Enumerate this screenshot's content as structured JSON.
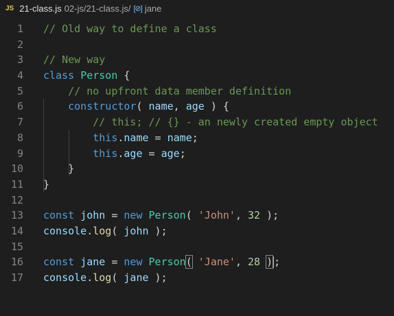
{
  "breadcrumb": {
    "language_badge": "JS",
    "file_name": "21-class.js",
    "path": "02-js/21-class.js/",
    "symbol_icon": "[⊘]",
    "symbol_name": "jane"
  },
  "lines": [
    {
      "n": "1",
      "tokens": [
        {
          "t": "// Old way to define a class",
          "c": "cm"
        }
      ]
    },
    {
      "n": "2",
      "tokens": []
    },
    {
      "n": "3",
      "tokens": [
        {
          "t": "// New way",
          "c": "cm"
        }
      ]
    },
    {
      "n": "4",
      "tokens": [
        {
          "t": "class",
          "c": "kw"
        },
        {
          "t": " ",
          "c": "plain"
        },
        {
          "t": "Person",
          "c": "cls"
        },
        {
          "t": " {",
          "c": "plain"
        }
      ]
    },
    {
      "n": "5",
      "tokens": [
        {
          "t": "    ",
          "c": "plain"
        },
        {
          "t": "// no upfront data member definition",
          "c": "cm"
        }
      ]
    },
    {
      "n": "6",
      "tokens": [
        {
          "t": "    ",
          "c": "plain"
        },
        {
          "t": "constructor",
          "c": "kw"
        },
        {
          "t": "( ",
          "c": "plain"
        },
        {
          "t": "name",
          "c": "var"
        },
        {
          "t": ", ",
          "c": "plain"
        },
        {
          "t": "age",
          "c": "var"
        },
        {
          "t": " ) {",
          "c": "plain"
        }
      ]
    },
    {
      "n": "7",
      "tokens": [
        {
          "t": "        ",
          "c": "plain"
        },
        {
          "t": "// this; // {} - an newly created empty object",
          "c": "cm"
        }
      ]
    },
    {
      "n": "8",
      "tokens": [
        {
          "t": "        ",
          "c": "plain"
        },
        {
          "t": "this",
          "c": "kw"
        },
        {
          "t": ".",
          "c": "plain"
        },
        {
          "t": "name",
          "c": "var"
        },
        {
          "t": " = ",
          "c": "plain"
        },
        {
          "t": "name",
          "c": "var"
        },
        {
          "t": ";",
          "c": "plain"
        }
      ]
    },
    {
      "n": "9",
      "tokens": [
        {
          "t": "        ",
          "c": "plain"
        },
        {
          "t": "this",
          "c": "kw"
        },
        {
          "t": ".",
          "c": "plain"
        },
        {
          "t": "age",
          "c": "var"
        },
        {
          "t": " = ",
          "c": "plain"
        },
        {
          "t": "age",
          "c": "var"
        },
        {
          "t": ";",
          "c": "plain"
        }
      ]
    },
    {
      "n": "10",
      "tokens": [
        {
          "t": "    }",
          "c": "plain"
        }
      ]
    },
    {
      "n": "11",
      "tokens": [
        {
          "t": "}",
          "c": "plain"
        }
      ]
    },
    {
      "n": "12",
      "tokens": []
    },
    {
      "n": "13",
      "tokens": [
        {
          "t": "const",
          "c": "kw"
        },
        {
          "t": " ",
          "c": "plain"
        },
        {
          "t": "john",
          "c": "var"
        },
        {
          "t": " = ",
          "c": "plain"
        },
        {
          "t": "new",
          "c": "kw"
        },
        {
          "t": " ",
          "c": "plain"
        },
        {
          "t": "Person",
          "c": "cls"
        },
        {
          "t": "( ",
          "c": "plain"
        },
        {
          "t": "'John'",
          "c": "str"
        },
        {
          "t": ", ",
          "c": "plain"
        },
        {
          "t": "32",
          "c": "num"
        },
        {
          "t": " );",
          "c": "plain"
        }
      ]
    },
    {
      "n": "14",
      "tokens": [
        {
          "t": "console",
          "c": "var"
        },
        {
          "t": ".",
          "c": "plain"
        },
        {
          "t": "log",
          "c": "fn"
        },
        {
          "t": "( ",
          "c": "plain"
        },
        {
          "t": "john",
          "c": "var"
        },
        {
          "t": " );",
          "c": "plain"
        }
      ]
    },
    {
      "n": "15",
      "tokens": []
    },
    {
      "n": "16",
      "tokens": [
        {
          "t": "const",
          "c": "kw"
        },
        {
          "t": " ",
          "c": "plain"
        },
        {
          "t": "jane",
          "c": "var"
        },
        {
          "t": " = ",
          "c": "plain"
        },
        {
          "t": "new",
          "c": "kw"
        },
        {
          "t": " ",
          "c": "plain"
        },
        {
          "t": "Person",
          "c": "cls"
        },
        {
          "t": "(",
          "c": "plain",
          "hl": true
        },
        {
          "t": " ",
          "c": "plain"
        },
        {
          "t": "'Jane'",
          "c": "str"
        },
        {
          "t": ", ",
          "c": "plain"
        },
        {
          "t": "28",
          "c": "num"
        },
        {
          "t": " ",
          "c": "plain"
        },
        {
          "t": ")",
          "c": "plain",
          "hl": true,
          "cursor": true
        },
        {
          "t": ";",
          "c": "plain"
        }
      ]
    },
    {
      "n": "17",
      "tokens": [
        {
          "t": "console",
          "c": "var"
        },
        {
          "t": ".",
          "c": "plain"
        },
        {
          "t": "log",
          "c": "fn"
        },
        {
          "t": "( ",
          "c": "plain"
        },
        {
          "t": "jane",
          "c": "var"
        },
        {
          "t": " );",
          "c": "plain"
        }
      ]
    }
  ]
}
